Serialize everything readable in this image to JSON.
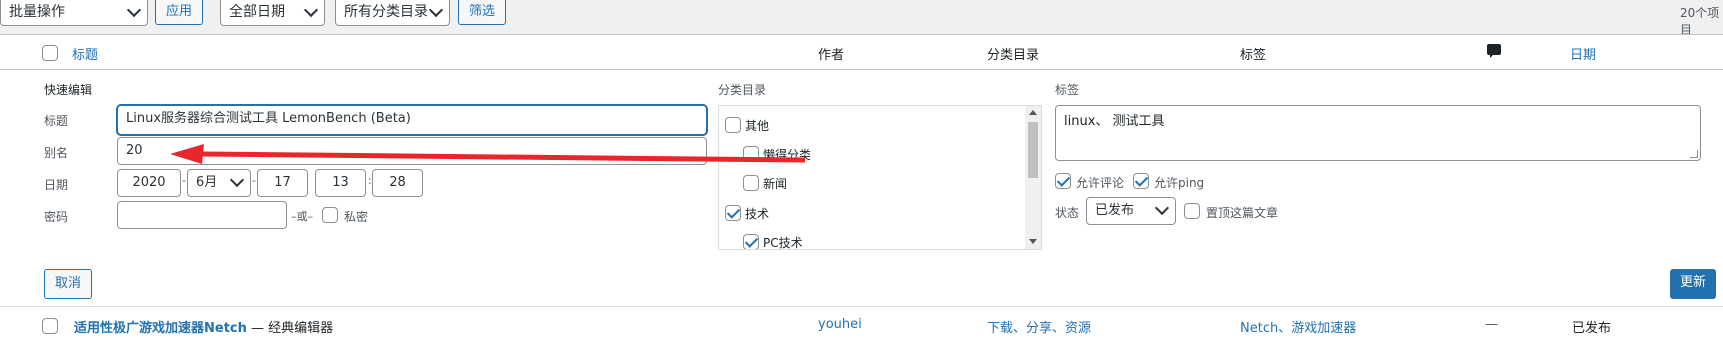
{
  "toolbar": {
    "bulk_action": "批量操作",
    "apply": "应用",
    "date_filter": "全部日期",
    "category_filter": "所有分类目录",
    "filter": "筛选",
    "items_count": "20个项目"
  },
  "table_header": {
    "title": "标题",
    "author": "作者",
    "categories": "分类目录",
    "tags": "标签",
    "date": "日期"
  },
  "quick_edit": {
    "heading": "快速编辑",
    "title_label": "标题",
    "title_value": "Linux服务器综合测试工具 LemonBench (Beta)",
    "slug_label": "别名",
    "slug_value": "20",
    "date_label": "日期",
    "year": "2020",
    "month": "6月",
    "day": "17",
    "hour": "13",
    "minute": "28",
    "dash": "-",
    "colon": ":",
    "password_label": "密码",
    "password_value": "",
    "or": "–或–",
    "private_label": "私密",
    "categories_label": "分类目录",
    "categories": [
      {
        "name": "其他",
        "checked": false
      },
      {
        "name": "懒得分类",
        "checked": false
      },
      {
        "name": "新闻",
        "checked": false
      },
      {
        "name": "技术",
        "checked": true
      },
      {
        "name": "PC技术",
        "checked": true
      }
    ],
    "tags_label": "标签",
    "tags_value": "linux、 测试工具",
    "allow_comments": "允许评论",
    "allow_ping": "允许ping",
    "status_label": "状态",
    "status_value": "已发布",
    "sticky_label": "置顶这篇文章",
    "cancel": "取消",
    "update": "更新"
  },
  "rows": [
    {
      "title": "适用性极广游戏加速器Netch",
      "suffix": " — 经典编辑器",
      "author": "youhei",
      "categories": "下载、分享、资源",
      "tags": "Netch、游戏加速器",
      "comments": "—",
      "status": "已发布"
    }
  ],
  "colors": {
    "accent": "#2271b1",
    "annotation_arrow": "#e8262d"
  }
}
